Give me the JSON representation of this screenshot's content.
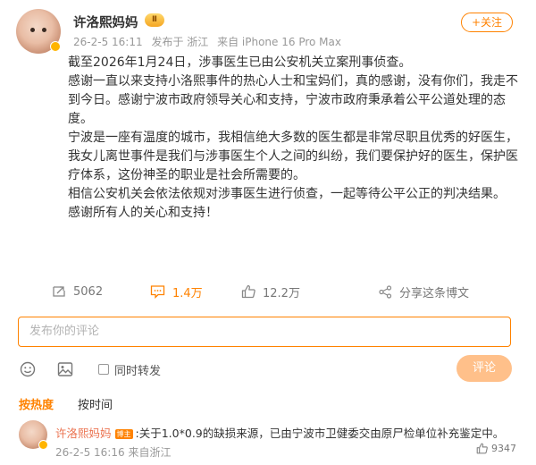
{
  "post": {
    "author": "许洛熙妈妈",
    "level_badge": "Ⅱ",
    "date": "26-2-5 16:11",
    "location": "发布于 浙江",
    "source": "来自 iPhone 16 Pro Max",
    "follow_label": "+关注",
    "paragraphs": [
      "截至2026年1月24日，涉事医生已由公安机关立案刑事侦查。",
      "感谢一直以来支持小洛熙事件的热心人士和宝妈们，真的感谢，没有你们，我走不到今日。感谢宁波市政府领导关心和支持，宁波市政府秉承着公平公道处理的态度。",
      "宁波是一座有温度的城市，我相信绝大多数的医生都是非常尽职且优秀的好医生，我女儿离世事件是我们与涉事医生个人之间的纠纷，我们要保护好的医生，保护医疗体系，这份神圣的职业是社会所需要的。",
      "相信公安机关会依法依规对涉事医生进行侦查，一起等待公平公正的判决结果。",
      "感谢所有人的关心和支持！"
    ]
  },
  "actions": {
    "repost_count": "5062",
    "comment_count": "1.4万",
    "like_count": "12.2万",
    "share_label": "分享这条博文"
  },
  "comment_box": {
    "placeholder": "发布你的评论",
    "repost_label": "同时转发",
    "submit_label": "评论"
  },
  "sort": {
    "hot_label": "按热度",
    "time_label": "按时间"
  },
  "comments": [
    {
      "author": "许洛熙妈妈",
      "author_tag": "博主",
      "text": "关于1.0*0.9的缺损来源，已由宁波市卫健委交由原尸检单位补充鉴定中。",
      "date": "26-2-5 16:16",
      "location": "来自浙江",
      "likes": "9347"
    }
  ],
  "colors": {
    "accent": "#ff8200",
    "username_link": "#eb7350",
    "muted": "#999999"
  },
  "icons": [
    "repost-icon",
    "comment-icon",
    "like-icon",
    "share-icon",
    "emoji-icon",
    "image-icon",
    "verified-badge-icon"
  ]
}
